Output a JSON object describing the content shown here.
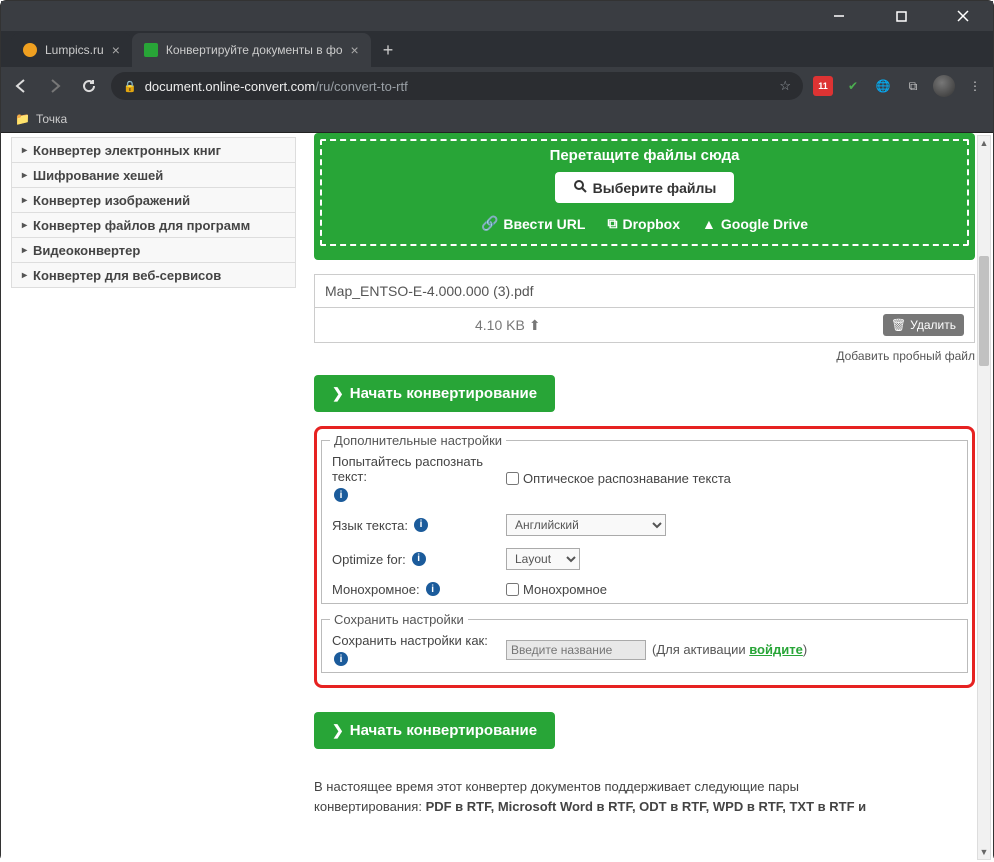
{
  "window": {
    "tabs": [
      {
        "label": "Lumpics.ru",
        "favicon": "#f0a020",
        "active": false
      },
      {
        "label": "Конвертируйте документы в фо",
        "favicon": "#28a537",
        "active": true
      }
    ],
    "url_domain": "document.online-convert.com",
    "url_path": "/ru/convert-to-rtf",
    "ext_badge": "11",
    "bookmark": "Точка"
  },
  "sidebar": {
    "items": [
      "Конвертер электронных книг",
      "Шифрование хешей",
      "Конвертер изображений",
      "Конвертер файлов для программ",
      "Видеоконвертер",
      "Конвертер для веб-сервисов"
    ]
  },
  "dropzone": {
    "title": "Перетащите файлы сюда",
    "choose": "Выберите файлы",
    "url": "Ввести URL",
    "dropbox": "Dropbox",
    "gdrive": "Google Drive"
  },
  "file": {
    "name": "Map_ENTSO-E-4.000.000 (3).pdf",
    "size": "4.10 KB",
    "delete": "Удалить"
  },
  "add_trial": "Добавить пробный файл",
  "start": "Начать конвертирование",
  "settings": {
    "legend1": "Дополнительные настройки",
    "ocr_label": "Попытайтесь распознать текст:",
    "ocr_check": "Оптическое распознавание текста",
    "lang_label": "Язык текста:",
    "lang_value": "Английский",
    "opt_label": "Optimize for:",
    "opt_value": "Layout",
    "mono_label": "Монохромное:",
    "mono_check": "Монохромное",
    "legend2": "Сохранить настройки",
    "save_label": "Сохранить настройки как:",
    "save_placeholder": "Введите название",
    "save_after1": "(Для активации ",
    "save_link": "войдите",
    "save_after2": ")"
  },
  "footer": {
    "line1": "В настоящее время этот конвертер документов поддерживает следующие пары",
    "line2_pre": "конвертирования: ",
    "pairs": "PDF в RTF, Microsoft Word в RTF, ODT в RTF, WPD в RTF, TXT в RTF и"
  }
}
